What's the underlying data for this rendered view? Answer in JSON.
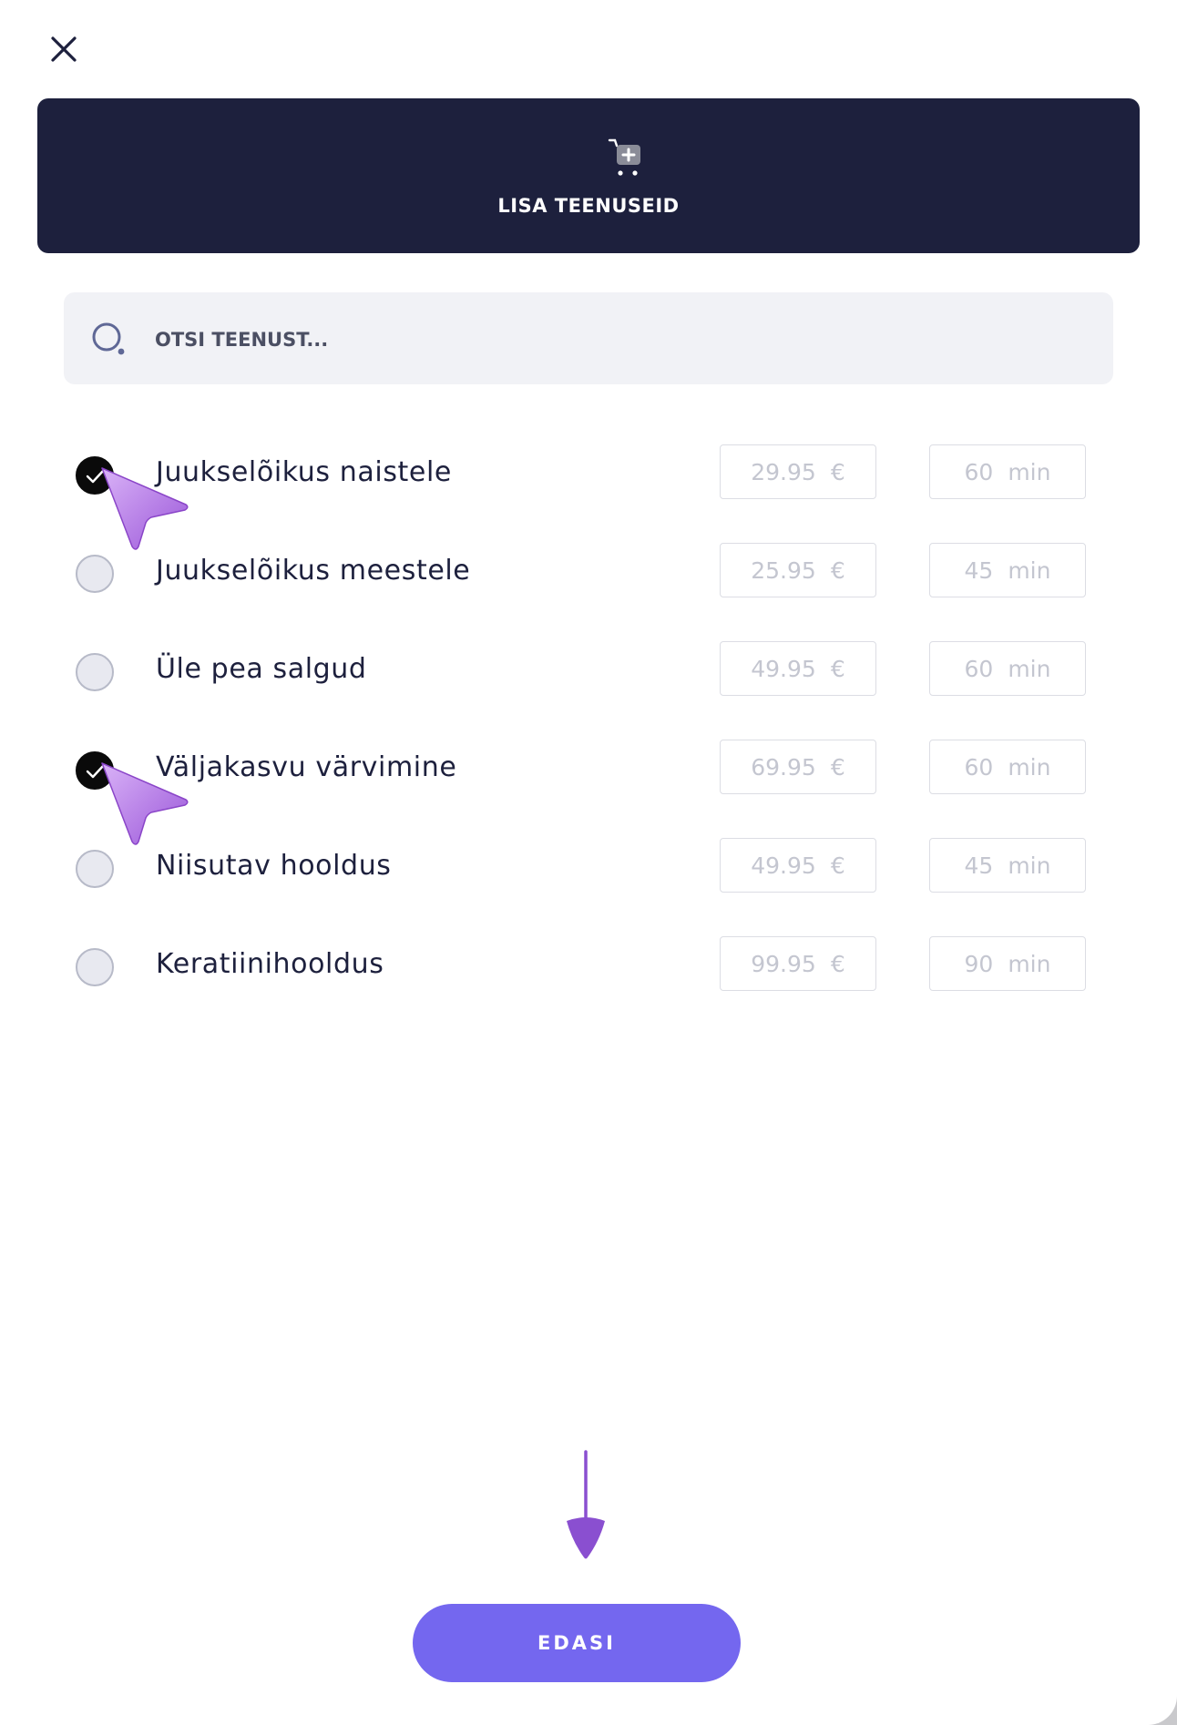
{
  "header": {
    "title": "LISA TEENUSEID",
    "icon": "cart-plus-icon"
  },
  "search": {
    "placeholder": "OTSI TEENUST..."
  },
  "services": [
    {
      "name": "Juukselõikus naistele",
      "price": "29.95",
      "currency": "€",
      "duration": "60",
      "unit": "min",
      "checked": true
    },
    {
      "name": "Juukselõikus meestele",
      "price": "25.95",
      "currency": "€",
      "duration": "45",
      "unit": "min",
      "checked": false
    },
    {
      "name": "Üle pea salgud",
      "price": "49.95",
      "currency": "€",
      "duration": "60",
      "unit": "min",
      "checked": false
    },
    {
      "name": "Väljakasvu värvimine",
      "price": "69.95",
      "currency": "€",
      "duration": "60",
      "unit": "min",
      "checked": true
    },
    {
      "name": "Niisutav hooldus",
      "price": "49.95",
      "currency": "€",
      "duration": "45",
      "unit": "min",
      "checked": false
    },
    {
      "name": "Keratiinihooldus",
      "price": "99.95",
      "currency": "€",
      "duration": "90",
      "unit": "min",
      "checked": false
    }
  ],
  "footer": {
    "next_label": "EDASI"
  },
  "colors": {
    "header_bg": "#1d203d",
    "accent": "#7467ef",
    "pointer": "#b57be8"
  }
}
